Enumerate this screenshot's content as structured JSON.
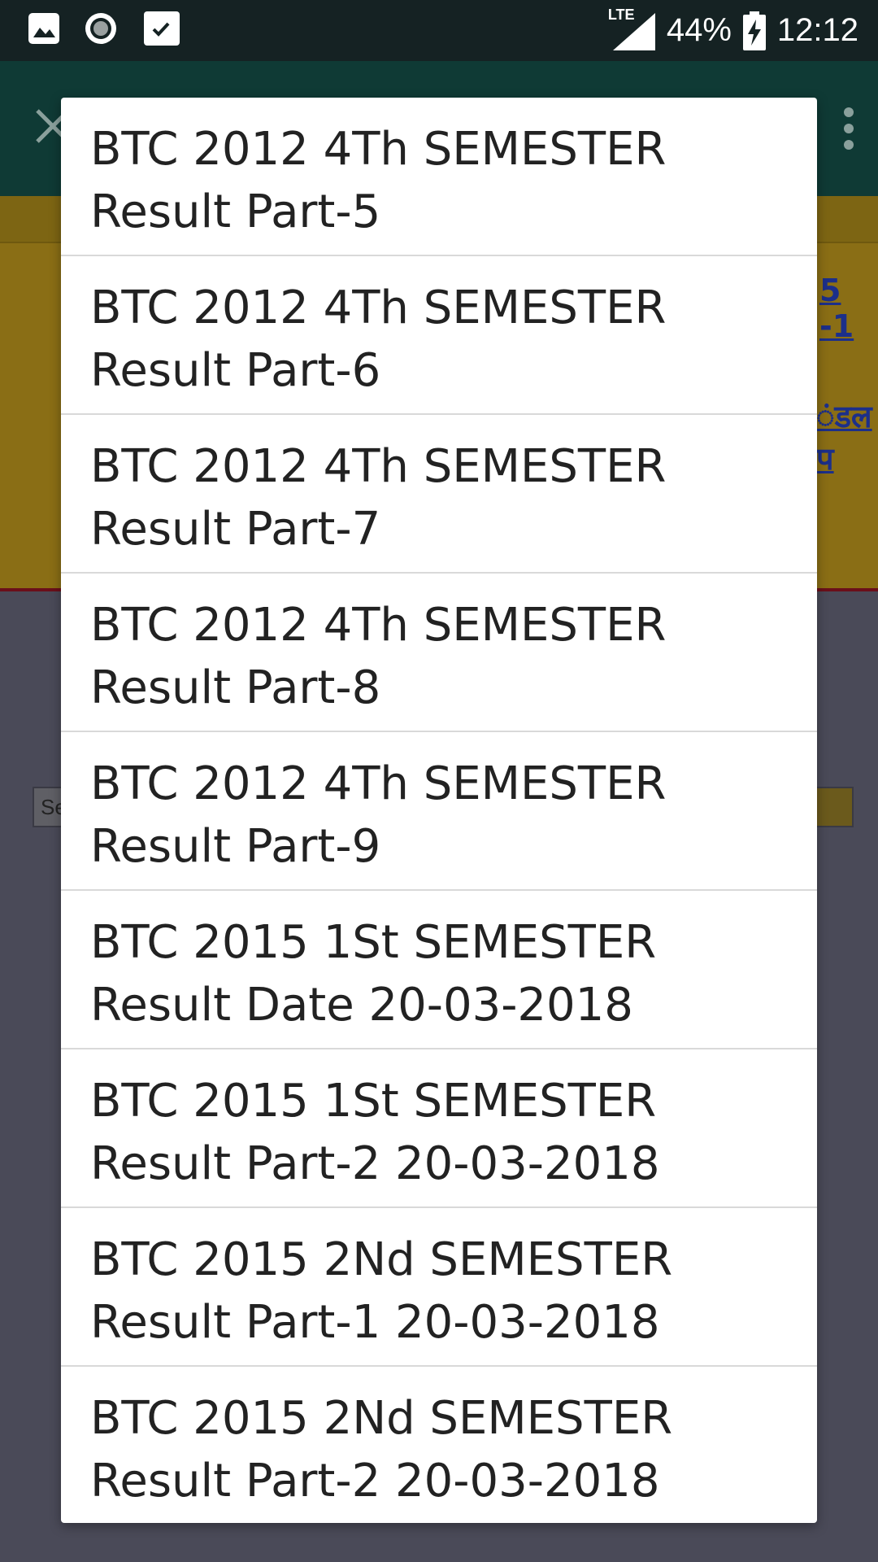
{
  "status_bar": {
    "left_icons": [
      "image-icon",
      "record-icon",
      "checkbox-icon"
    ],
    "network": "LTE",
    "battery": "44%",
    "time": "12:12"
  },
  "background": {
    "link_1": "5 -1",
    "link_2": "ंडल प",
    "select_text": "Se"
  },
  "dialog": {
    "items": [
      {
        "line1": "BTC 2012 4Th SEMESTER",
        "line2": "Result Part-5"
      },
      {
        "line1": "BTC 2012 4Th SEMESTER",
        "line2": "Result Part-6"
      },
      {
        "line1": "BTC 2012 4Th SEMESTER",
        "line2": "Result Part-7"
      },
      {
        "line1": "BTC 2012 4Th SEMESTER",
        "line2": "Result Part-8"
      },
      {
        "line1": "BTC 2012 4Th SEMESTER",
        "line2": "Result Part-9"
      },
      {
        "line1": "BTC 2015 1St SEMESTER",
        "line2": "Result Date 20-03-2018"
      },
      {
        "line1": "BTC 2015 1St SEMESTER",
        "line2": "Result Part-2 20-03-2018"
      },
      {
        "line1": "BTC 2015 2Nd SEMESTER",
        "line2": "Result Part-1 20-03-2018"
      },
      {
        "line1": "BTC 2015 2Nd SEMESTER",
        "line2": "Result Part-2 20-03-2018"
      }
    ]
  }
}
